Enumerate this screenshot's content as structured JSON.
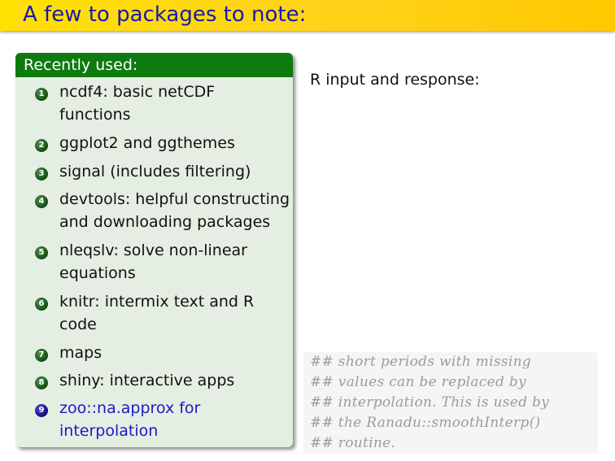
{
  "title": "A few to packages to note:",
  "block": {
    "header": "Recently used:",
    "items": [
      {
        "num": "1",
        "line1": "ncdf4: basic netCDF",
        "line2": "functions"
      },
      {
        "num": "2",
        "line1": "ggplot2 and ggthemes",
        "line2": ""
      },
      {
        "num": "3",
        "line1": "signal (includes filtering)",
        "line2": ""
      },
      {
        "num": "4",
        "line1": "devtools: helpful constructing",
        "line2": "and downloading packages"
      },
      {
        "num": "5",
        "line1": "nleqslv: solve non-linear",
        "line2": "equations"
      },
      {
        "num": "6",
        "line1": "knitr: intermix text and R",
        "line2": "code"
      },
      {
        "num": "7",
        "line1": "maps",
        "line2": ""
      },
      {
        "num": "8",
        "line1": "shiny: interactive apps",
        "line2": ""
      },
      {
        "num": "9",
        "line1": "zoo::na.approx for",
        "line2": "interpolation"
      }
    ]
  },
  "right": {
    "label": "R input and response:",
    "code_lines": [
      "## short periods with missing",
      "## values can be replaced by",
      "## interpolation. This is used by",
      "## the Ranadu::smoothInterp()",
      "## routine."
    ]
  },
  "colors": {
    "title_text": "#1a1aa8",
    "title_bar": "#ffd21a",
    "block_header": "#0f7a0f",
    "block_body": "#e5eee2",
    "highlight_item": "#1a1ac8",
    "code_comment": "#9b9b9b"
  }
}
